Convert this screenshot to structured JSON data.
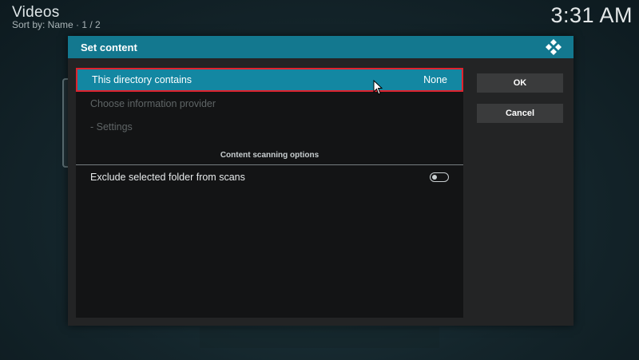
{
  "background": {
    "title": "Videos",
    "subtitle": "Sort by: Name  ·  1 / 2",
    "clock": "3:31 AM"
  },
  "dialog": {
    "title": "Set content",
    "rows": [
      {
        "label": "This directory contains",
        "value": "None",
        "state": "selected"
      },
      {
        "label": "Choose information provider",
        "state": "disabled"
      },
      {
        "label": "- Settings",
        "state": "disabled"
      }
    ],
    "section_header": "Content scanning options",
    "exclude_row": {
      "label": "Exclude selected folder from scans",
      "toggle_on": false
    },
    "buttons": {
      "ok": "OK",
      "cancel": "Cancel"
    }
  },
  "colors": {
    "header": "#13788f",
    "selected_row": "#1387a2",
    "focus_border": "#e0232f"
  },
  "icons": [
    "kodi-logo-icon",
    "mouse-pointer-icon",
    "toggle-switch-icon"
  ]
}
